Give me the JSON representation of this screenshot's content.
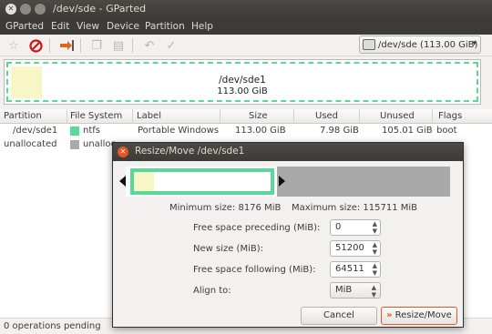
{
  "window": {
    "title": "/dev/sde - GParted"
  },
  "menu": [
    "GParted",
    "Edit",
    "View",
    "Device",
    "Partition",
    "Help"
  ],
  "toolbar": {
    "device_selector": "/dev/sde  (113.00 GiB)"
  },
  "graph": {
    "partition_name": "/dev/sde1",
    "partition_size": "113.00 GiB"
  },
  "table": {
    "columns": [
      "Partition",
      "File System",
      "Label",
      "Size",
      "Used",
      "Unused",
      "Flags"
    ],
    "rows": [
      {
        "partition": "/dev/sde1",
        "filesystem": "ntfs",
        "label": "Portable Windows",
        "size": "113.00 GiB",
        "used": "7.98 GiB",
        "unused": "105.01 GiB",
        "flags": "boot",
        "swatch": "#5ad89a"
      },
      {
        "partition": "unallocated",
        "filesystem": "unalloc",
        "label": "",
        "size": "",
        "used": "",
        "unused": "",
        "flags": "",
        "swatch": "#a9a9a9"
      }
    ]
  },
  "status": {
    "text": "0 operations pending"
  },
  "dialog": {
    "title": "Resize/Move /dev/sde1",
    "min_size": "Minimum size: 8176 MiB",
    "max_size": "Maximum size: 115711 MiB",
    "fields": [
      {
        "label": "Free space preceding (MiB):",
        "value": "0"
      },
      {
        "label": "New size (MiB):",
        "value": "51200"
      },
      {
        "label": "Free space following (MiB):",
        "value": "64511"
      }
    ],
    "align_label": "Align to:",
    "align_value": "MiB",
    "cancel_label": "Cancel",
    "resize_label": "Resize/Move"
  }
}
